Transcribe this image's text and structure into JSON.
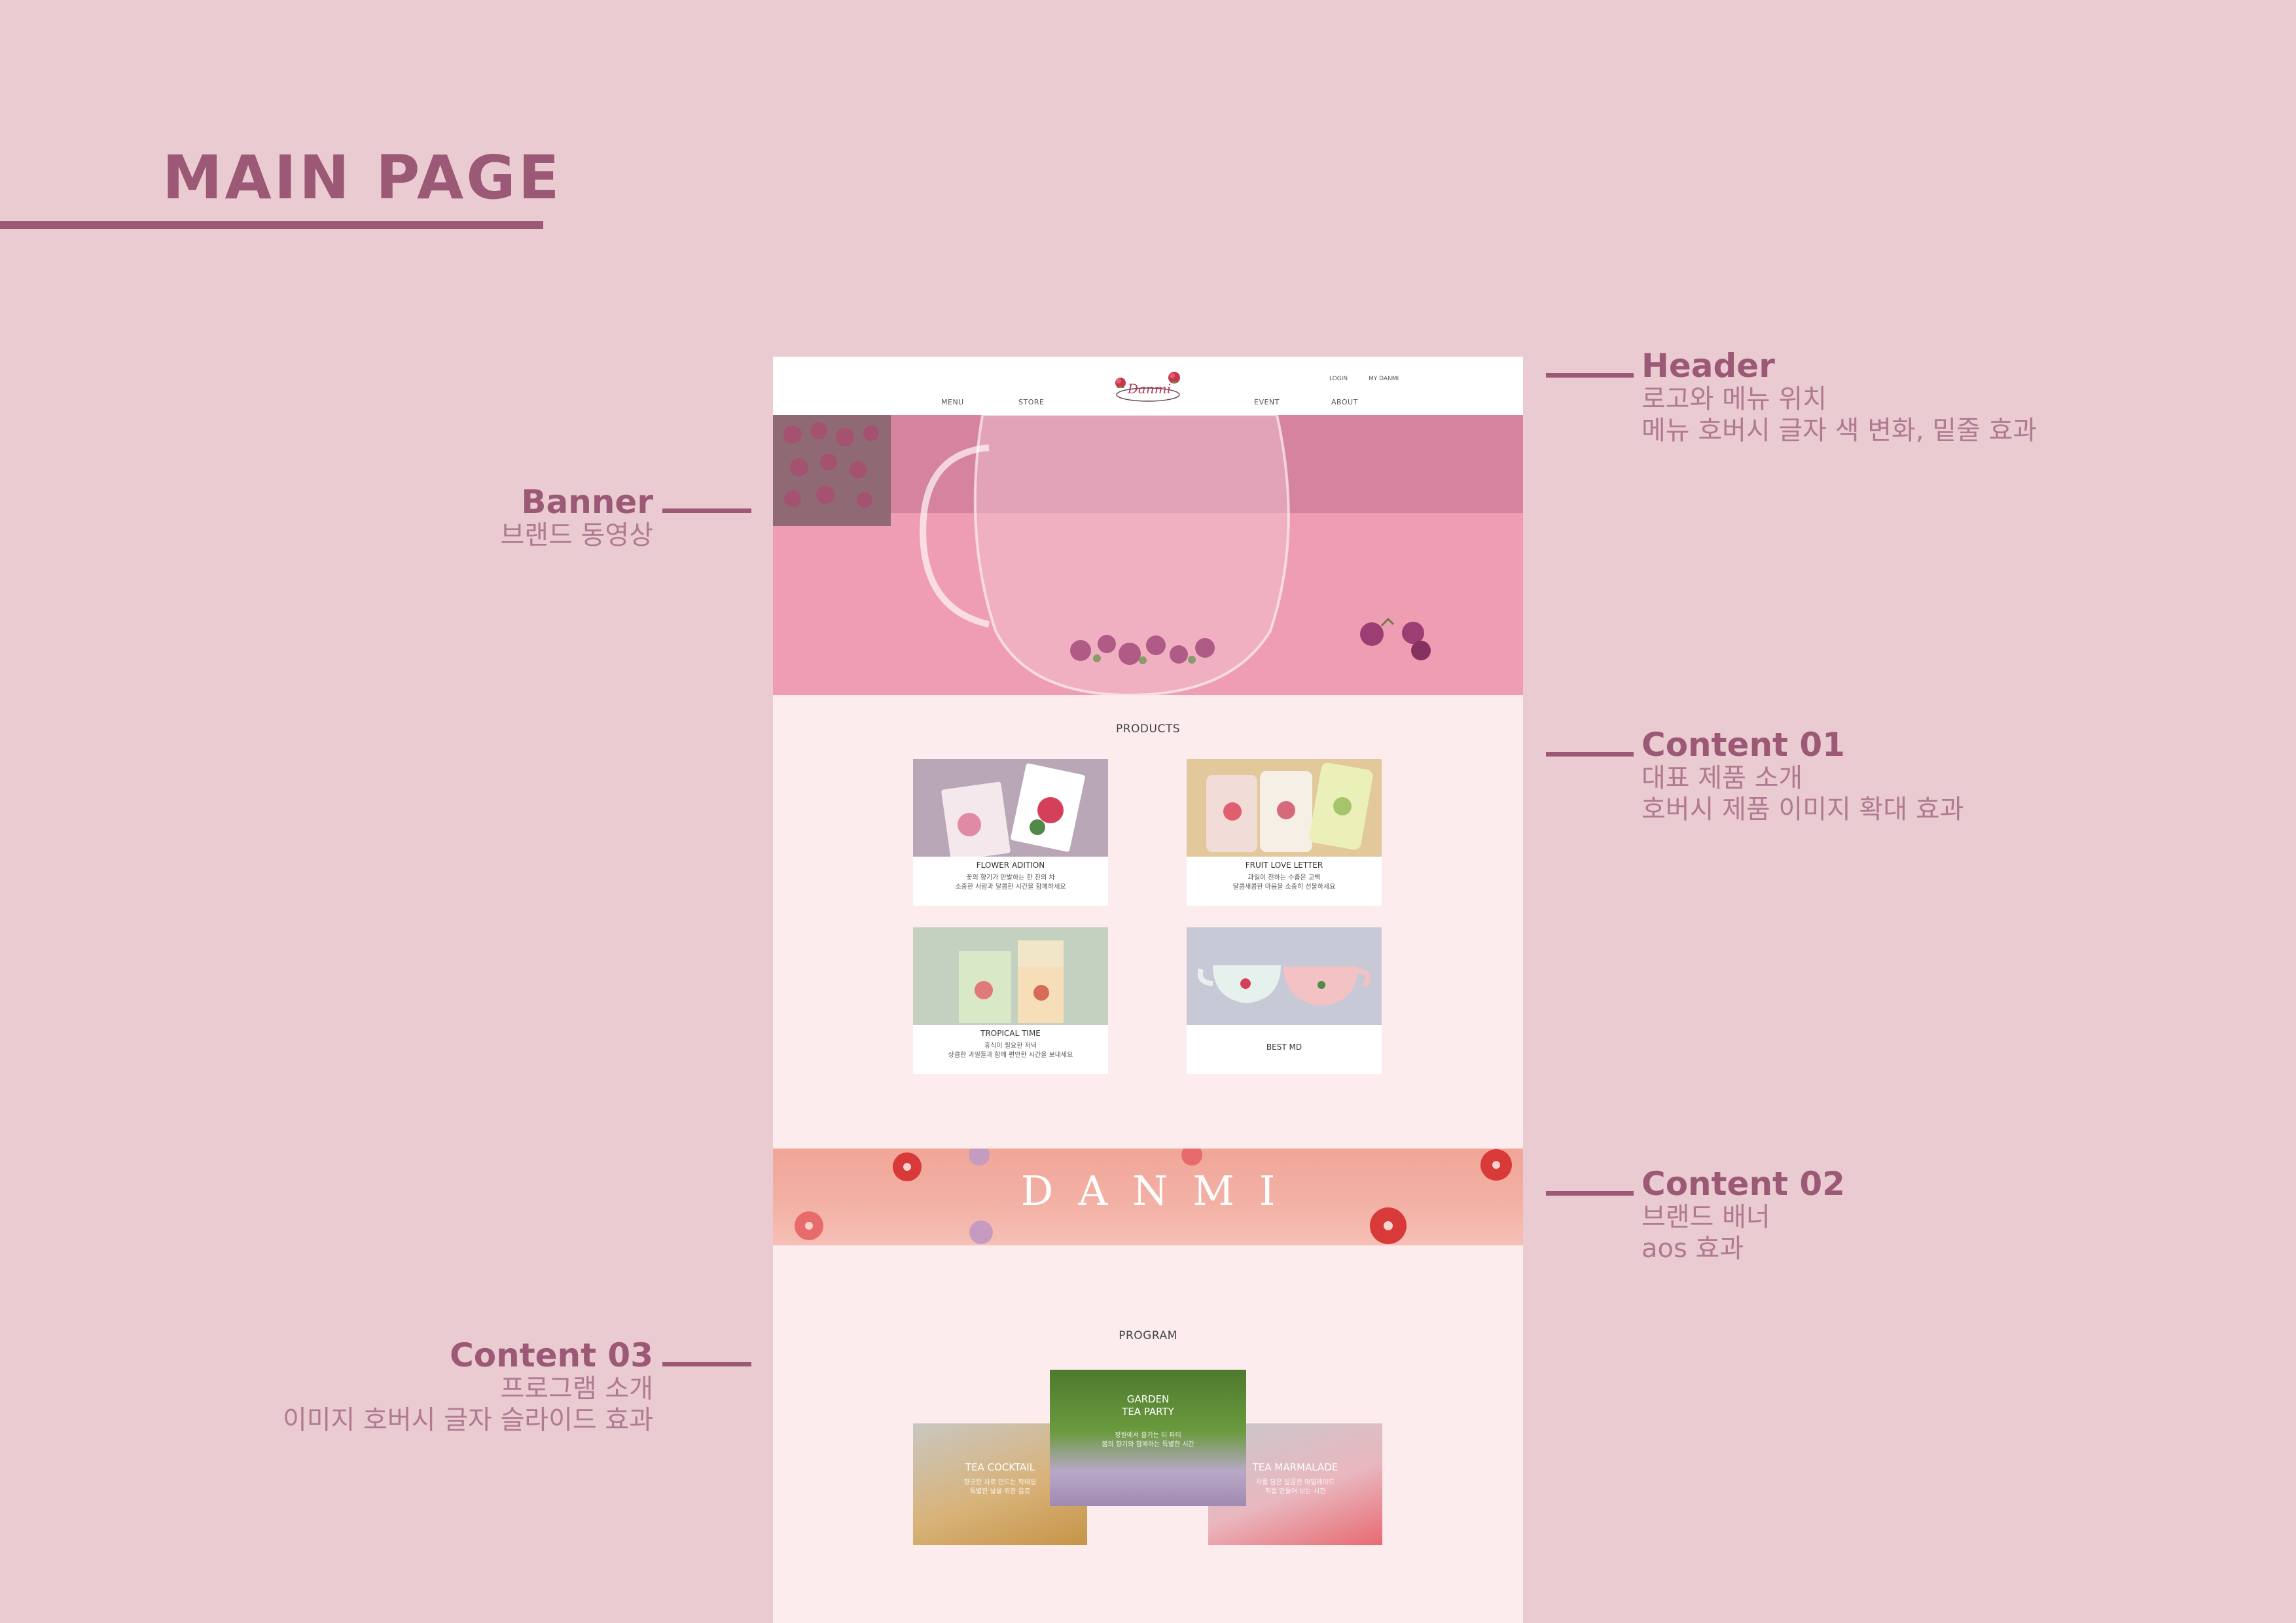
{
  "page": {
    "title": "MAIN PAGE"
  },
  "annotations": {
    "header": {
      "title": "Header",
      "lines": [
        "로고와 메뉴 위치",
        "메뉴 호버시 글자 색 변화, 밑줄 효과"
      ]
    },
    "banner": {
      "title": "Banner",
      "lines": [
        "브랜드 동영상"
      ]
    },
    "content01": {
      "title": "Content 01",
      "lines": [
        "대표 제품 소개",
        "호버시 제품 이미지 확대 효과"
      ]
    },
    "content02": {
      "title": "Content 02",
      "lines": [
        "브랜드 배너",
        "aos 효과"
      ]
    },
    "content03": {
      "title": "Content 03",
      "lines": [
        "프로그램 소개",
        "이미지 호버시 글자 슬라이드 효과"
      ]
    }
  },
  "site": {
    "logo_text": "Danmi",
    "nav": [
      "MENU",
      "STORE",
      "EVENT",
      "ABOUT"
    ],
    "utility": [
      "LOGIN",
      "MY DANMI"
    ],
    "products": {
      "title": "PRODUCTS",
      "items": [
        {
          "name": "FLOWER ADITION",
          "desc": [
            "꽃의 향기가 만발하는 한 잔의 차",
            "소중한 사람과 달콤한 시간을 함께하세요"
          ]
        },
        {
          "name": "FRUIT LOVE LETTER",
          "desc": [
            "과일이 전하는 수줍은 고백",
            "달콤새콤한 마음을 소중히 선물하세요"
          ]
        },
        {
          "name": "TROPICAL TIME",
          "desc": [
            "휴식이 필요한 저녁",
            "상큼한 과일들과 함께 편안한 시간을 보내세요"
          ]
        },
        {
          "name": "BEST MD",
          "desc": []
        }
      ]
    },
    "brand_banner": {
      "text": "DANMI"
    },
    "program": {
      "title": "PROGRAM",
      "items": [
        {
          "name": "TEA COCKTAIL",
          "desc": [
            "향긋한 차로 만드는 칵테일",
            "특별한 날을 위한 음료"
          ]
        },
        {
          "name_lines": [
            "GARDEN",
            "TEA PARTY"
          ],
          "desc": [
            "정원에서 즐기는 티 파티",
            "봄의 향기와 함께하는 특별한 시간"
          ]
        },
        {
          "name": "TEA MARMALADE",
          "desc": [
            "차를 담은 달콤한 마멀레이드",
            "직접 만들어 보는 시간"
          ]
        }
      ]
    }
  },
  "colors": {
    "accent": "#9c5976",
    "background": "#eacbd1",
    "mock_bg": "#fdeced"
  }
}
